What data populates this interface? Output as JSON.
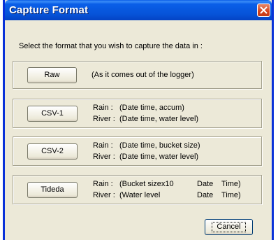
{
  "window": {
    "title": "Capture Format"
  },
  "prompt": "Select the format that you wish to capture the data in :",
  "options": [
    {
      "button": "Raw",
      "line1": "(As it comes out of the logger)"
    },
    {
      "button": "CSV-1",
      "rain_label": "Rain :",
      "rain": "(Date time, accum)",
      "river_label": "River :",
      "river": "(Date time, water level)"
    },
    {
      "button": "CSV-2",
      "rain_label": "Rain :",
      "rain": "(Date time, bucket size)",
      "river_label": "River :",
      "river": "(Date time, water level)"
    },
    {
      "button": "Tideda",
      "rain_label": "Rain :",
      "rain_a": "(Bucket sizex10",
      "rain_b": "Date",
      "rain_c": "Time)",
      "river_label": "River :",
      "river_a": "(Water level",
      "river_b": "Date",
      "river_c": "Time)"
    }
  ],
  "cancel_label": "Cancel",
  "icons": {
    "close": "close-icon"
  }
}
